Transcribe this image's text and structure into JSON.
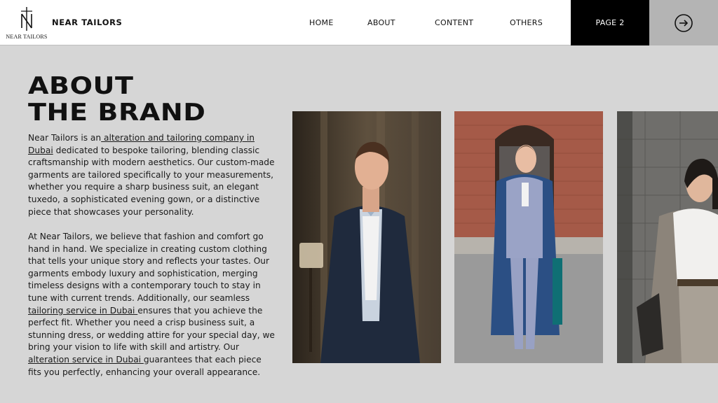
{
  "header": {
    "logo_monogram": "N",
    "logo_subtitle": "NEAR TAILORS",
    "brand_name": "NEAR TAILORS",
    "nav": {
      "home": "HOME",
      "about": "ABOUT",
      "content": "CONTENT",
      "others": "OTHERS"
    },
    "page_button": "PAGE 2",
    "next_icon": "arrow-right-circle-icon"
  },
  "main": {
    "title_line1": "ABOUT",
    "title_line2": "THE BRAND",
    "p1": {
      "before": "Near Tailors is an",
      "link": " alteration and tailoring company in Dubai",
      "after": " dedicated to bespoke tailoring, blending classic craftsmanship with modern aesthetics. Our custom-made garments are tailored specifically to your measurements, whether you require a sharp business suit, an elegant tuxedo, a sophisticated evening gown, or a distinctive piece that showcases your personality."
    },
    "p2": {
      "part1": "At Near Tailors, we believe that fashion and comfort go hand in hand. We specialize in creating custom clothing that tells your unique story and reflects your tastes. Our garments embody luxury and sophistication, merging timeless designs with a contemporary touch to stay in tune with current trends. Additionally, our seamless ",
      "link1": "tailoring service in Dubai ",
      "part2": "ensures that you achieve the perfect fit. Whether you need a crisp business suit, a stunning dress, or wedding attire for your special day, we bring your vision to life with skill and artistry. Our ",
      "link2": "alteration service in Dubai ",
      "part3": "guarantees that each piece fits you perfectly, enhancing your overall appearance."
    }
  },
  "colors": {
    "background": "#d6d6d6",
    "header_bg": "#ffffff",
    "page_button_bg": "#000000",
    "arrow_button_bg": "#b4b4b4"
  }
}
